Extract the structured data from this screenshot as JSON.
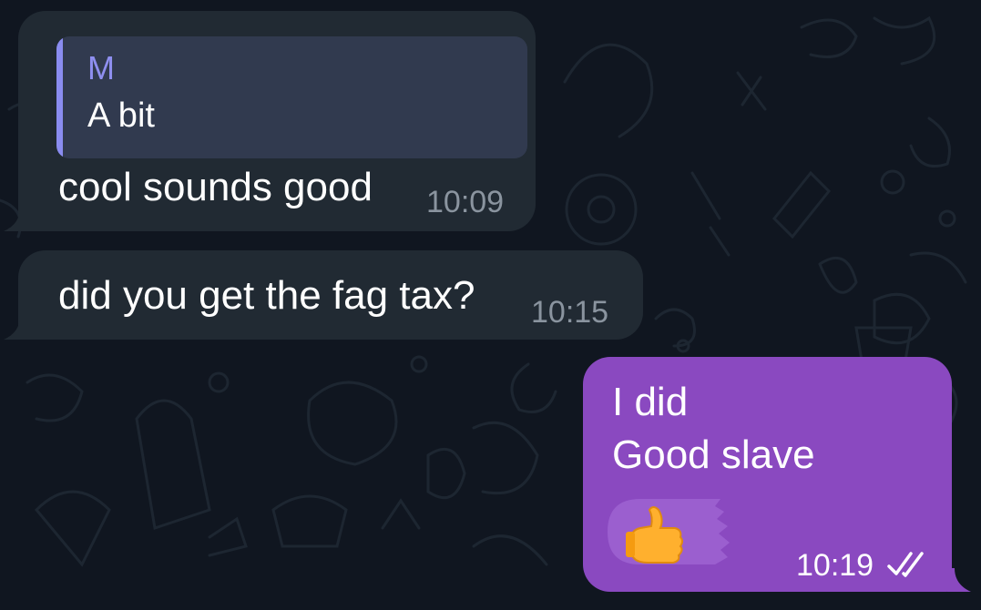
{
  "messages": [
    {
      "direction": "incoming",
      "reply": {
        "author": "M",
        "text": "A bit"
      },
      "text": "cool sounds good",
      "time": "10:09"
    },
    {
      "direction": "incoming",
      "text": "did you get the fag tax?",
      "time": "10:15"
    },
    {
      "direction": "outgoing",
      "lines": [
        "I did",
        "Good slave"
      ],
      "reaction": "thumbs-up-emoji",
      "time": "10:19",
      "status": "read-double-check"
    }
  ],
  "colors": {
    "background": "#101620",
    "incoming_bubble": "#212a33",
    "outgoing_bubble": "#8a49c0",
    "reply_accent": "#8a8cf0",
    "reply_background": "#313a4f",
    "incoming_time": "#8a949f"
  }
}
